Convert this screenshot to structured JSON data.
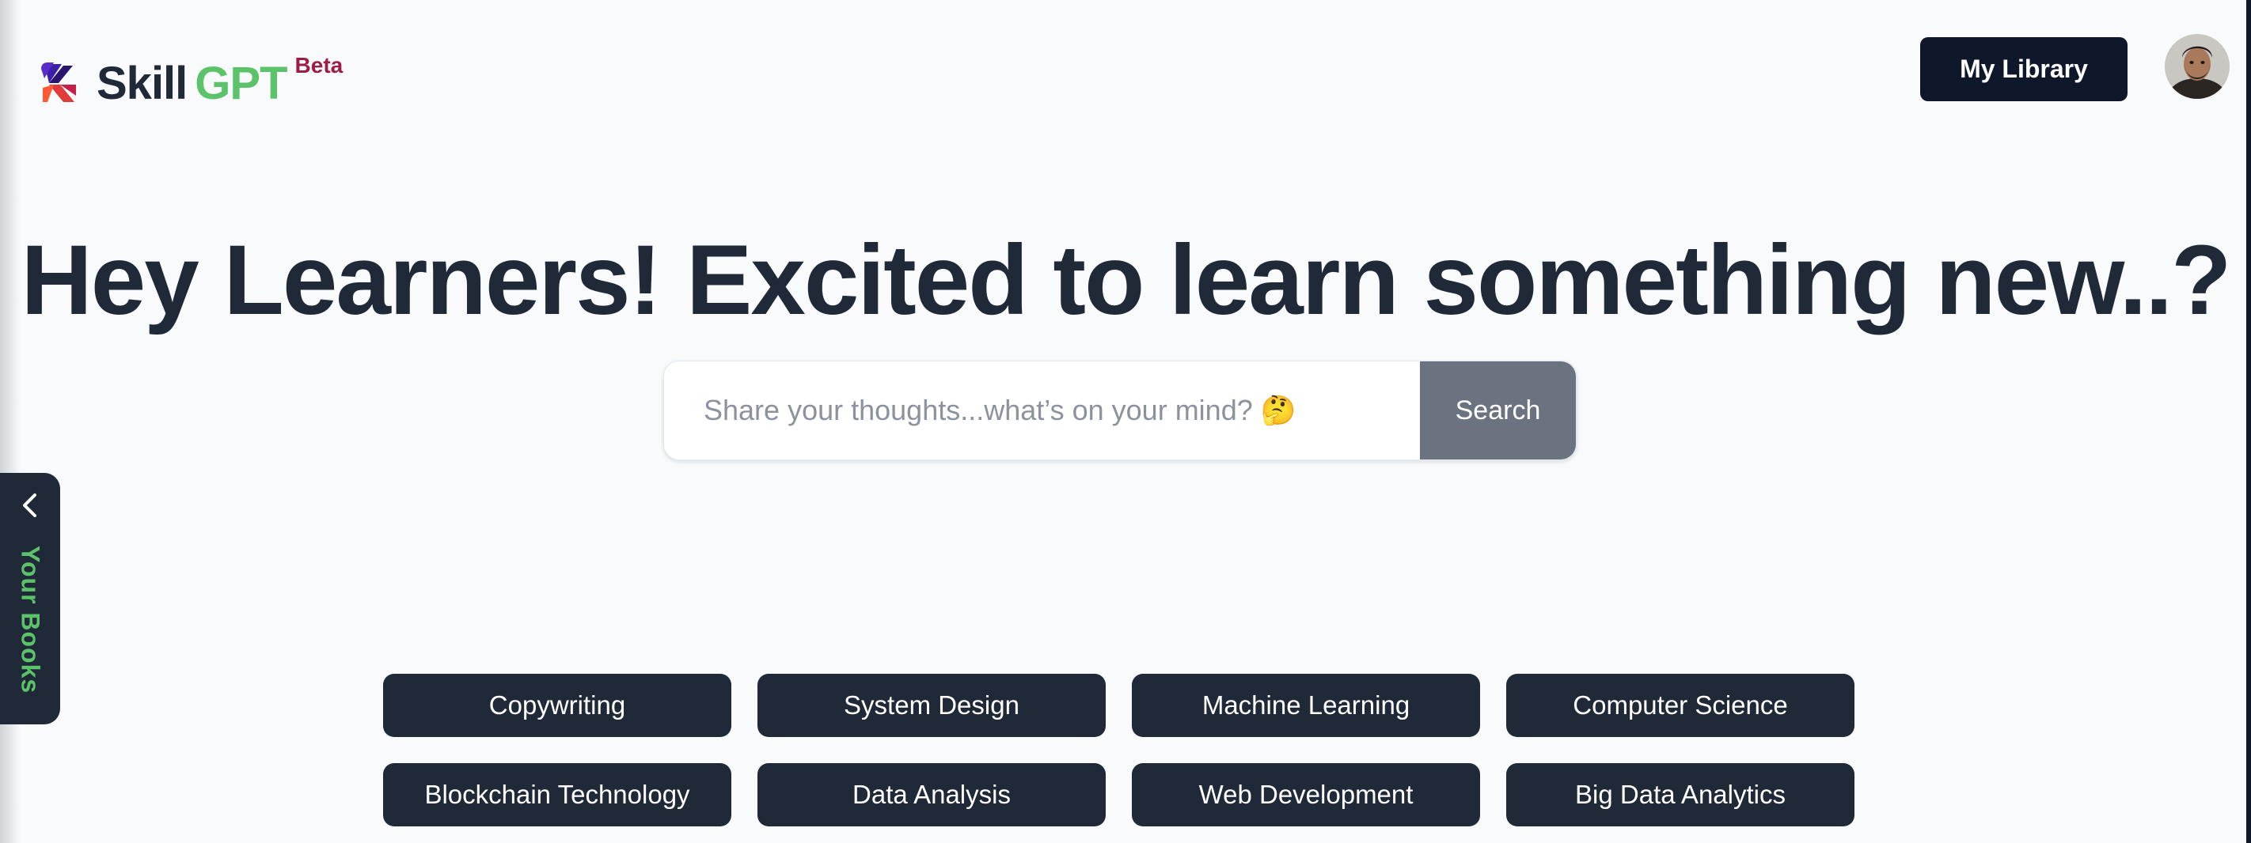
{
  "brand": {
    "name_part1": "Skill",
    "name_part2": "GPT",
    "badge": "Beta",
    "colors": {
      "dark": "#1f2937",
      "green": "#5cc36b",
      "badge": "#9d1c45"
    }
  },
  "header": {
    "library_label": "My Library",
    "avatar_icon": "user-avatar"
  },
  "hero": {
    "title": "Hey Learners! Excited to learn something new..?"
  },
  "search": {
    "placeholder": "Share your thoughts...what’s on your mind? 🤔",
    "button_label": "Search"
  },
  "side_panel": {
    "label": "Your Books",
    "icon": "chevron-left-icon"
  },
  "topics": [
    "Copywriting",
    "System Design",
    "Machine Learning",
    "Computer Science",
    "Blockchain Technology",
    "Data Analysis",
    "Web Development",
    "Big Data Analytics"
  ]
}
